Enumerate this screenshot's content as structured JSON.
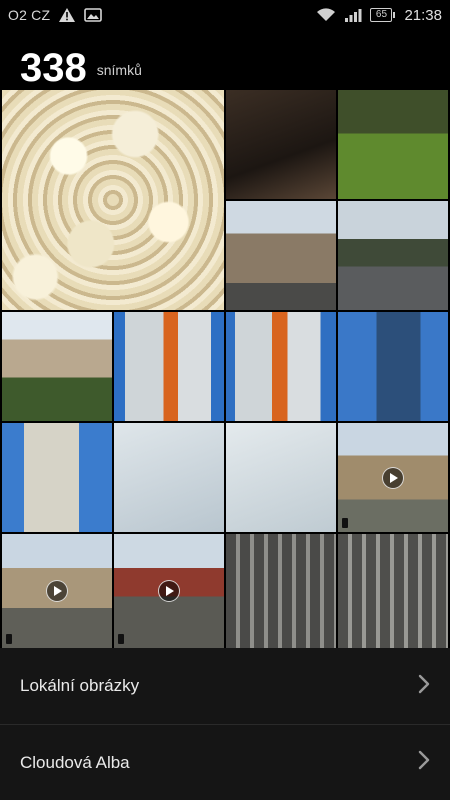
{
  "statusbar": {
    "carrier": "O2 CZ",
    "battery": "65",
    "time": "21:38",
    "icons": [
      "warning-icon",
      "image-icon",
      "wifi-icon",
      "signal-icon",
      "battery-icon"
    ]
  },
  "header": {
    "count": "338",
    "label": "snímků"
  },
  "gallery": {
    "tiles": [
      {
        "name": "photo-popcorn"
      },
      {
        "name": "photo-indoor-box"
      },
      {
        "name": "photo-grass-wall"
      },
      {
        "name": "photo-house-street"
      },
      {
        "name": "photo-parking-lot"
      },
      {
        "name": "photo-apartment-block"
      },
      {
        "name": "photo-tower-1"
      },
      {
        "name": "photo-tower-2"
      },
      {
        "name": "photo-glass-tower"
      },
      {
        "name": "photo-office-building"
      },
      {
        "name": "photo-ticket-1"
      },
      {
        "name": "photo-ticket-2"
      },
      {
        "name": "video-square-bus"
      },
      {
        "name": "video-square-1"
      },
      {
        "name": "video-square-2"
      },
      {
        "name": "photo-colonnade-1"
      },
      {
        "name": "photo-colonnade-2"
      }
    ]
  },
  "menu": {
    "items": [
      {
        "label": "Lokální obrázky"
      },
      {
        "label": "Cloudová Alba"
      }
    ]
  },
  "colors": {
    "background": "#000000",
    "menu_background": "#151515",
    "text": "#ffffff"
  }
}
